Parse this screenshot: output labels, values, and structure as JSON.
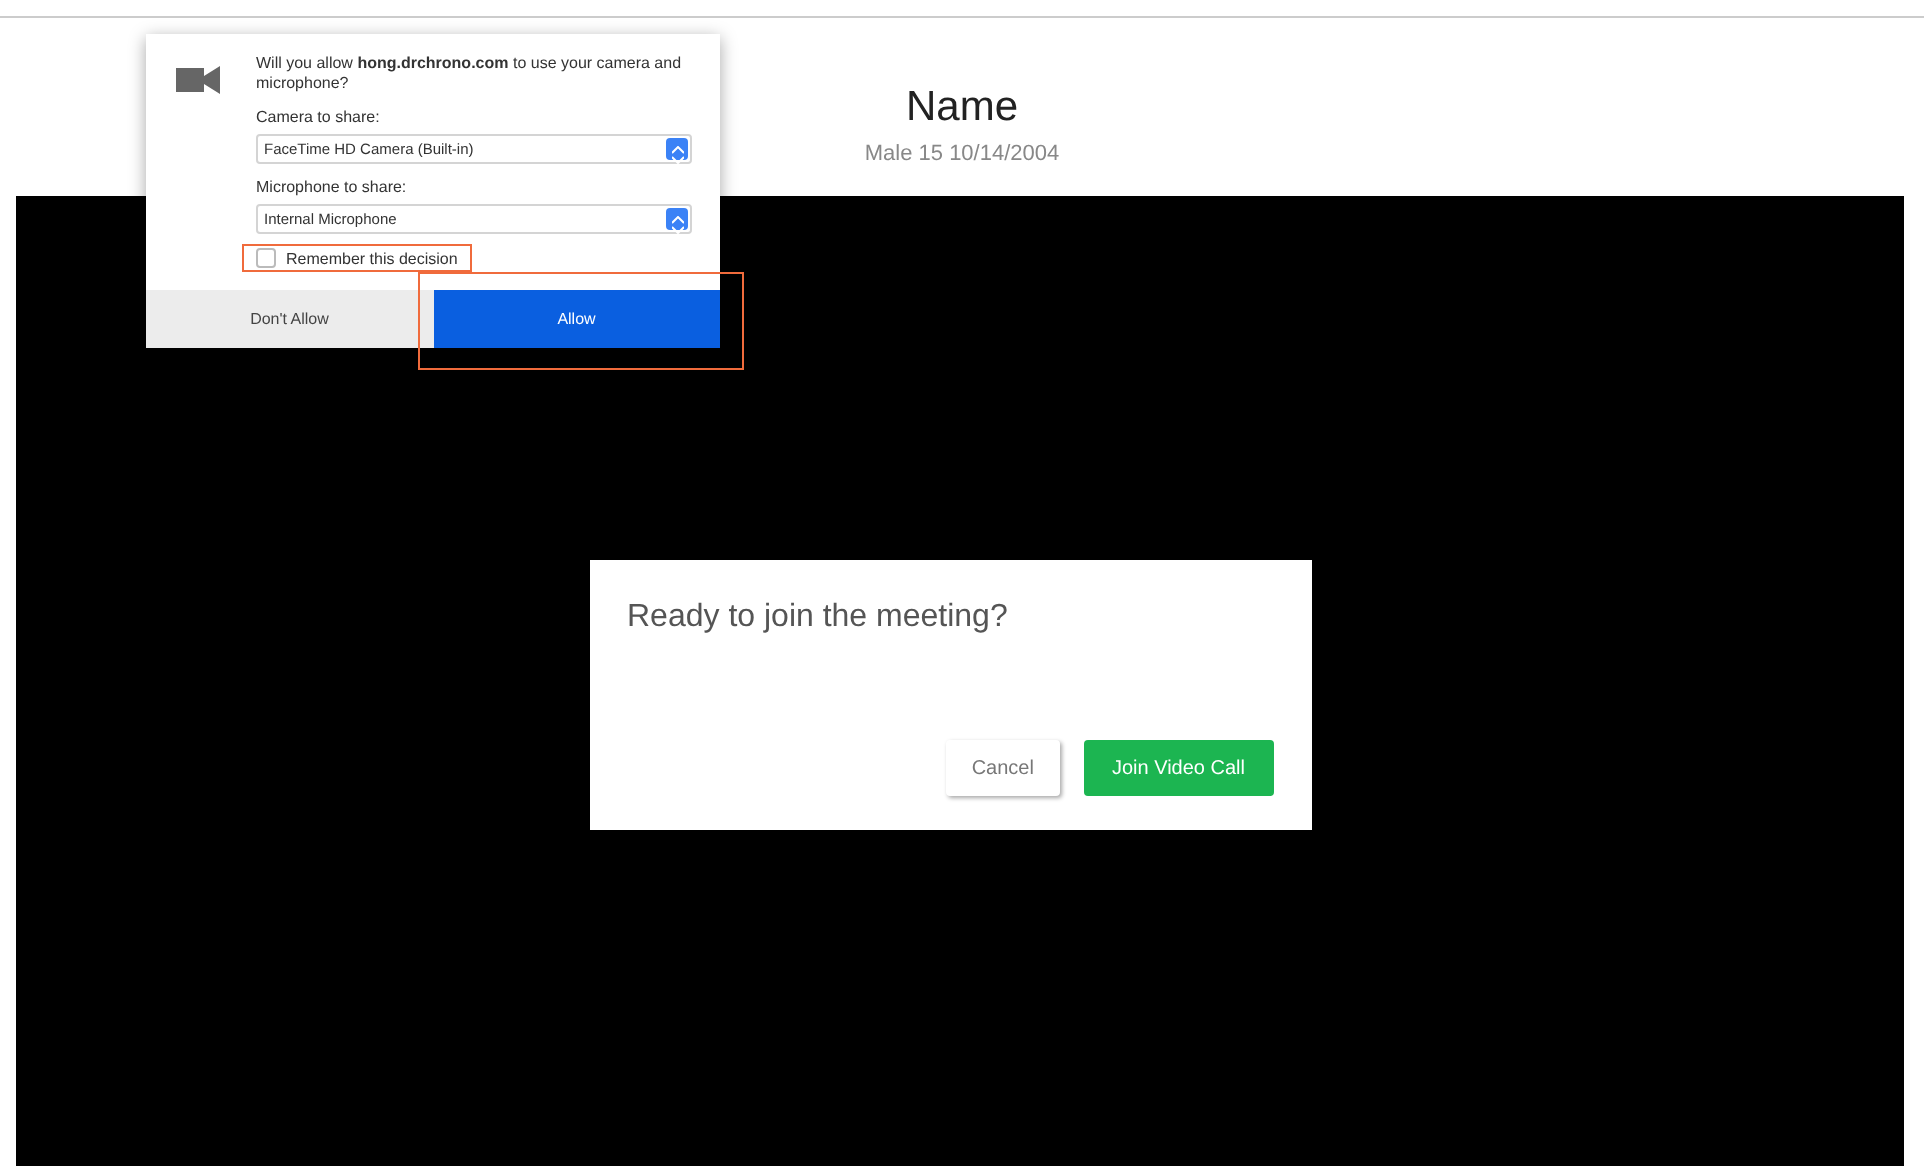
{
  "header": {
    "name": "Name",
    "details": "Male 15 10/14/2004"
  },
  "permission_prompt": {
    "message": "Will you allow **hong.drchrono.com** to use your camera and microphone?",
    "camera_label": "Camera to share:",
    "camera_value": "FaceTime HD Camera (Built-in)",
    "microphone_label": "Microphone to share:",
    "microphone_value": "Internal Microphone",
    "remember": {
      "label": "Remember this decision",
      "checked": false,
      "highlighted": true
    },
    "buttons": [
      {
        "label": "Don't Allow",
        "kind": "secondary",
        "highlighted": false
      },
      {
        "label": "Allow",
        "kind": "primary",
        "highlighted": true
      }
    ]
  },
  "meeting_dialog": {
    "title": "Ready to join the meeting?",
    "buttons": [
      {
        "label": "Cancel",
        "kind": "secondary"
      },
      {
        "label": "Join Video Call",
        "kind": "primary"
      }
    ]
  }
}
